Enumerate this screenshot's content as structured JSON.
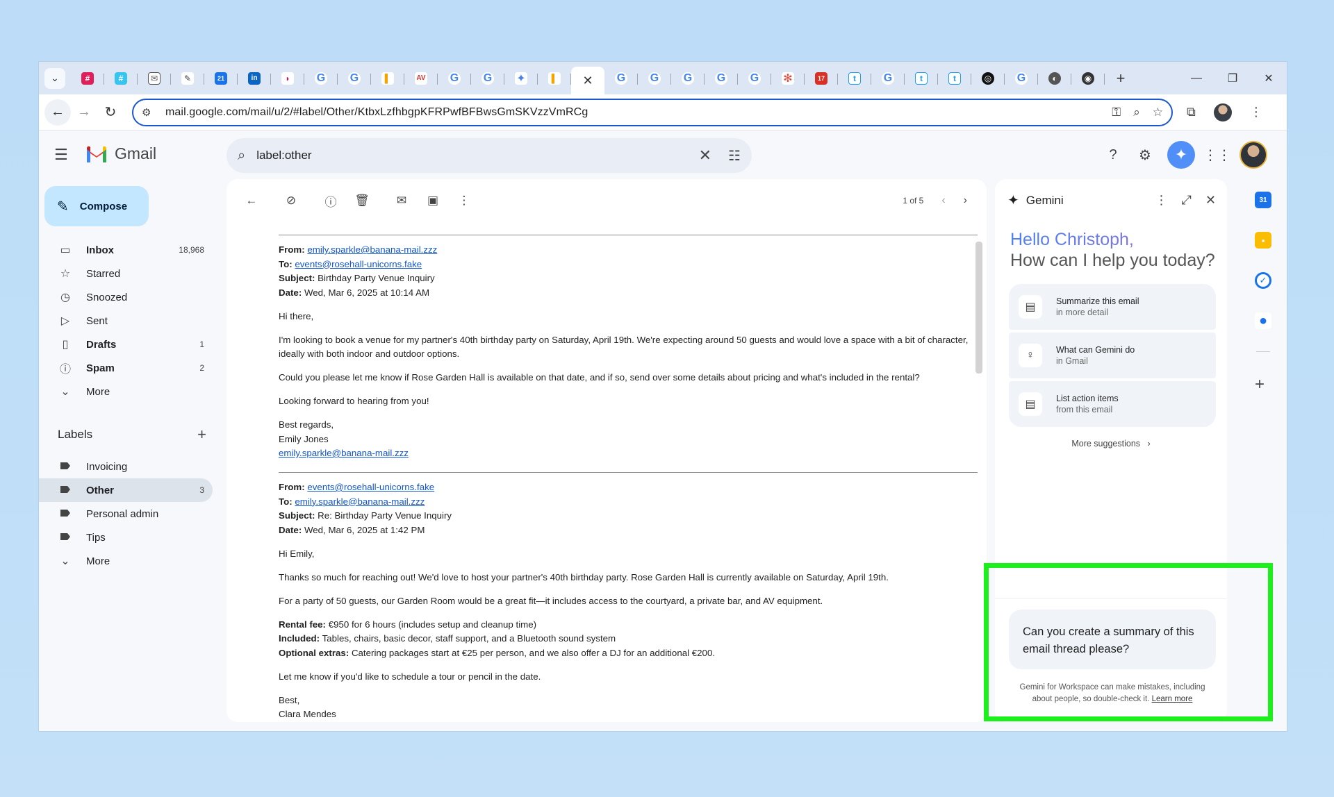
{
  "browser": {
    "url": "mail.google.com/mail/u/2/#label/Other/KtbxLzfhbgpKFRPwfBFBwsGmSKVzzVmRCg",
    "tab_count": 32
  },
  "gmail": {
    "logo_text": "Gmail",
    "search_value": "label:other",
    "compose_label": "Compose",
    "nav": [
      {
        "label": "Inbox",
        "count": "18,968",
        "icon": "inbox-icon",
        "bold": true
      },
      {
        "label": "Starred",
        "count": "",
        "icon": "star-icon",
        "bold": false
      },
      {
        "label": "Snoozed",
        "count": "",
        "icon": "clock-icon",
        "bold": false
      },
      {
        "label": "Sent",
        "count": "",
        "icon": "send-icon",
        "bold": false
      },
      {
        "label": "Drafts",
        "count": "1",
        "icon": "draft-icon",
        "bold": true
      },
      {
        "label": "Spam",
        "count": "2",
        "icon": "spam-icon",
        "bold": true
      },
      {
        "label": "More",
        "count": "",
        "icon": "chevron-down-icon",
        "bold": false
      }
    ],
    "labels_title": "Labels",
    "labels": [
      {
        "label": "Invoicing",
        "count": "",
        "bold": false
      },
      {
        "label": "Other",
        "count": "3",
        "bold": true
      },
      {
        "label": "Personal admin",
        "count": "",
        "bold": false
      },
      {
        "label": "Tips",
        "count": "",
        "bold": false
      }
    ],
    "labels_more": "More",
    "pager_text": "1 of 5"
  },
  "email": {
    "msg1": {
      "from_label": "From:",
      "from": "emily.sparkle@banana-mail.zzz",
      "to_label": "To:",
      "to": "events@rosehall-unicorns.fake",
      "subject_label": "Subject:",
      "subject": "Birthday Party Venue Inquiry",
      "date_label": "Date:",
      "date": "Wed, Mar 6, 2025 at 10:14 AM",
      "greeting": "Hi there,",
      "p1": "I'm looking to book a venue for my partner's 40th birthday party on Saturday, April 19th. We're expecting around 50 guests and would love a space with a bit of character, ideally with both indoor and outdoor options.",
      "p2": "Could you please let me know if Rose Garden Hall is available on that date, and if so, send over some details about pricing and what's included in the rental?",
      "p3": "Looking forward to hearing from you!",
      "sign1": "Best regards,",
      "sign2": "Emily Jones",
      "sign3": "emily.sparkle@banana-mail.zzz"
    },
    "msg2": {
      "from_label": "From:",
      "from": "events@rosehall-unicorns.fake",
      "to_label": "To:",
      "to": "emily.sparkle@banana-mail.zzz",
      "subject_label": "Subject:",
      "subject": "Re: Birthday Party Venue Inquiry",
      "date_label": "Date:",
      "date": "Wed, Mar 6, 2025 at 1:42 PM",
      "greeting": "Hi Emily,",
      "p1": "Thanks so much for reaching out! We'd love to host your partner's 40th birthday party. Rose Garden Hall is currently available on Saturday, April 19th.",
      "p2": "For a party of 50 guests, our Garden Room would be a great fit—it includes access to the courtyard, a private bar, and AV equipment.",
      "fee_label": "Rental fee:",
      "fee": "€950 for 6 hours (includes setup and cleanup time)",
      "incl_label": "Included:",
      "incl": "Tables, chairs, basic decor, staff support, and a Bluetooth sound system",
      "opt_label": "Optional extras:",
      "opt": "Catering packages start at €25 per person, and we also offer a DJ for an additional €200.",
      "p3": "Let me know if you'd like to schedule a tour or pencil in the date.",
      "sign1": "Best,",
      "sign2": "Clara Mendes"
    }
  },
  "gemini": {
    "title": "Gemini",
    "hello": "Hello Christoph,",
    "prompt": "How can I help you today?",
    "suggestions": [
      {
        "title": "Summarize this email",
        "sub": "in more detail"
      },
      {
        "title": "What can Gemini do",
        "sub": "in Gmail"
      },
      {
        "title": "List action items",
        "sub": "from this email"
      }
    ],
    "more_suggestions": "More suggestions",
    "user_message": "Can you create a summary of this email thread please?",
    "disclaimer": "Gemini for Workspace can make mistakes, including about people, so double-check it.",
    "learn_more": "Learn more"
  },
  "colors": {
    "highlight": "#1cef1c",
    "compose_bg": "#c2e7ff",
    "link": "#1155cc"
  }
}
